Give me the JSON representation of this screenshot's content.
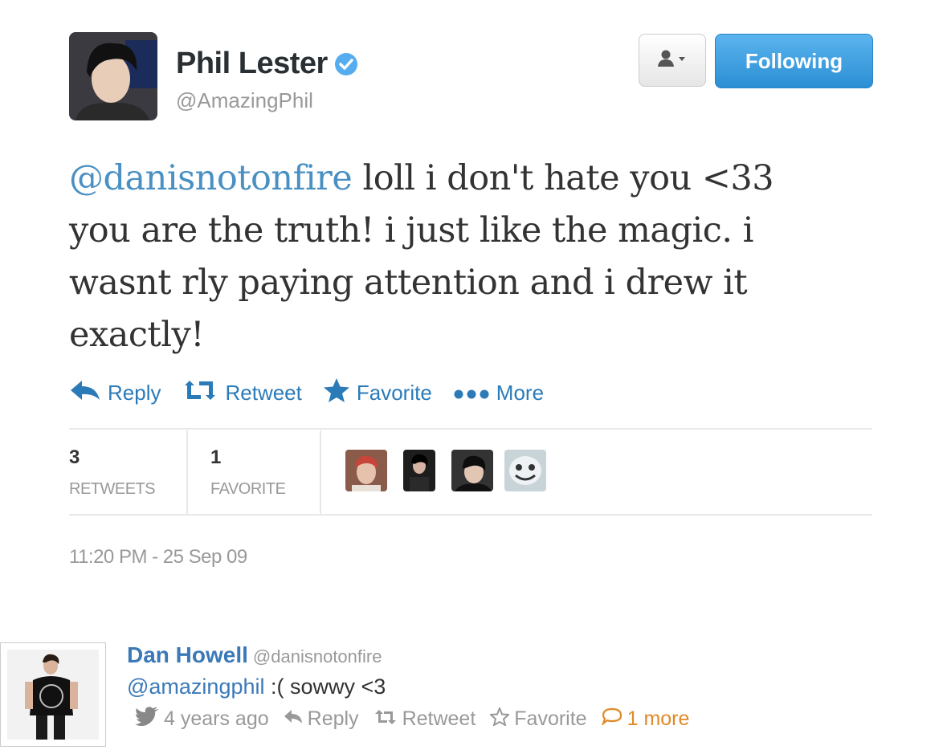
{
  "author": {
    "name": "Phil Lester",
    "handle": "@AmazingPhil"
  },
  "buttons": {
    "follow_label": "Following"
  },
  "tweet": {
    "mention": "@danisnotonfire",
    "text": " loll i don't hate you <33 you are the truth! i just like the magic. i wasnt rly paying attention and i drew it exactly!"
  },
  "actions": {
    "reply": "Reply",
    "retweet": "Retweet",
    "favorite": "Favorite",
    "more": "More"
  },
  "stats": {
    "retweets_count": "3",
    "retweets_label": "RETWEETS",
    "favorites_count": "1",
    "favorites_label": "FAVORITE"
  },
  "timestamp": "11:20 PM - 25 Sep 09",
  "reply": {
    "name": "Dan Howell",
    "handle": "@danisnotonfire",
    "mention": "@amazingphil",
    "text": " :( sowwy <3",
    "time": "4 years ago",
    "reply_label": "Reply",
    "retweet_label": "Retweet",
    "favorite_label": "Favorite",
    "more_label": "1 more"
  },
  "colors": {
    "link": "#2b7bb9",
    "follow_button": "#3a9ee0",
    "muted": "#999999"
  }
}
